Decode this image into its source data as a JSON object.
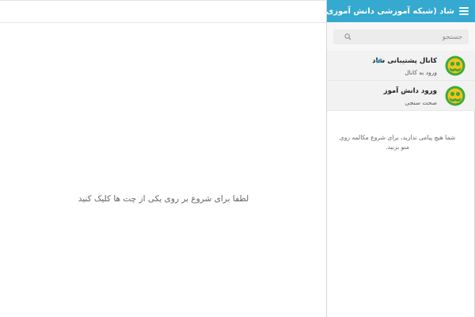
{
  "header": {
    "title": "شاد (شبکه آموزشی دانش آموزی)"
  },
  "search": {
    "placeholder": "جستجو"
  },
  "chats": [
    {
      "title": "کانال پشتیبانی شاد",
      "subtitle": "ورود به کانال",
      "icon": "megaphone-icon"
    },
    {
      "title": "ورود دانش آموز",
      "subtitle": "صحت سنجی"
    }
  ],
  "sidebar": {
    "no_messages": "شما هیچ پیامی ندارید، برای شروع مکالمه روی منو بزنید."
  },
  "main": {
    "empty_text": "لطفا برای شروع بر روی یکی از چت ها کلیک کنید"
  },
  "colors": {
    "header_bg": "#35a9d0",
    "avatar_green": "#3daa3b",
    "avatar_yellow": "#f2c21b"
  }
}
